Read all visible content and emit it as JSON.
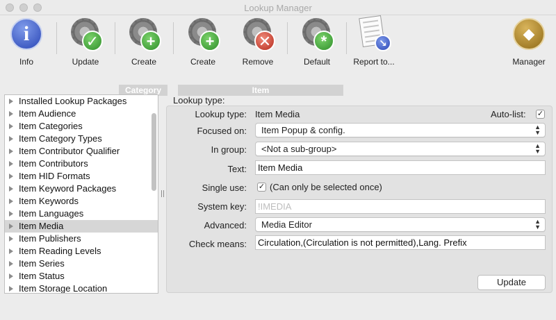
{
  "window": {
    "title": "Lookup Manager"
  },
  "toolbar": {
    "info": "Info",
    "update": "Update",
    "category_create": "Create",
    "item_create": "Create",
    "item_remove": "Remove",
    "item_default": "Default",
    "report": "Report to...",
    "manager": "Manager",
    "group_category": "Category",
    "group_item": "Item"
  },
  "list": {
    "items": [
      "Installed Lookup Packages",
      "Item Audience",
      "Item Categories",
      "Item Category Types",
      "Item Contributor Qualifier",
      "Item Contributors",
      "Item HID Formats",
      "Item Keyword Packages",
      "Item Keywords",
      "Item Languages",
      "Item Media",
      "Item Publishers",
      "Item Reading Levels",
      "Item Series",
      "Item Status",
      "Item Storage Location"
    ],
    "selected": "Item Media"
  },
  "form": {
    "section_title": "Lookup type:",
    "lookup_type_label": "Lookup type:",
    "lookup_type_value": "Item Media",
    "autolist_label": "Auto-list:",
    "autolist_checked": "✓",
    "focused_on_label": "Focused on:",
    "focused_on_value": "Item Popup & config.",
    "in_group_label": "In group:",
    "in_group_value": "<Not a sub-group>",
    "text_label": "Text:",
    "text_value": "Item Media",
    "single_use_label": "Single use:",
    "single_use_checked": "✓",
    "single_use_hint": "(Can only be selected once)",
    "system_key_label": "System key:",
    "system_key_value": "!IMEDIA",
    "advanced_label": "Advanced:",
    "advanced_value": "Media Editor",
    "check_means_label": "Check means:",
    "check_means_value": "Circulation,(Circulation is not permitted),Lang. Prefix",
    "update_button": "Update"
  },
  "icons": {
    "chevron": "⌃⌄",
    "check": "✓",
    "cross": "✕",
    "plus": "+",
    "asterisk": "*"
  }
}
